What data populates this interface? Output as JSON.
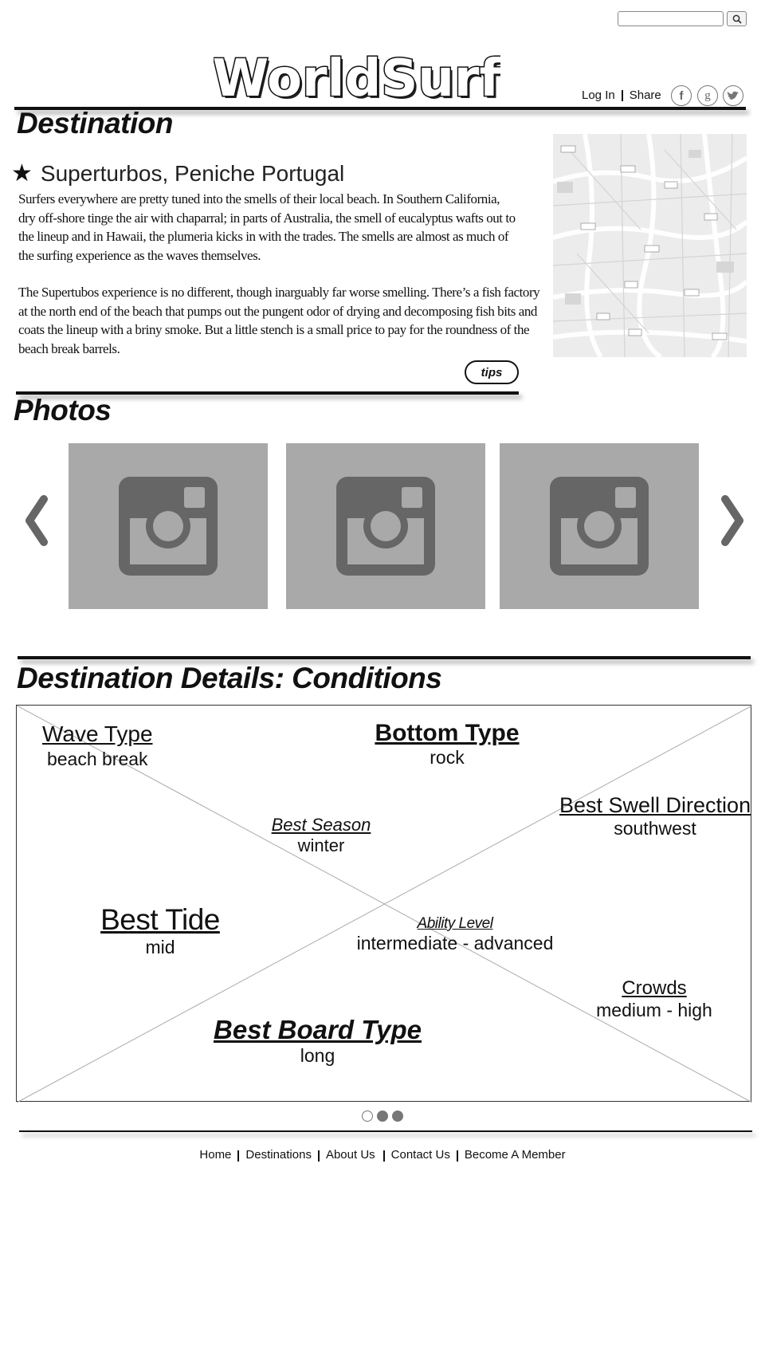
{
  "search": {
    "value": "",
    "placeholder": ""
  },
  "logo_text": "WorldSurf",
  "header": {
    "login": "Log In",
    "share": "Share"
  },
  "social": [
    "facebook-icon",
    "google-icon",
    "twitter-icon"
  ],
  "destination": {
    "title": "Destination",
    "name": "Superturbos, Peniche Portugal",
    "paragraphs": [
      "Surfers everywhere are pretty tuned into the smells of their local beach.  In Southern California, dry off-shore tinge the air with chaparral; in parts of Australia, the smell of eucalyptus wafts out to the lineup and in Hawaii, the plumeria kicks in with the trades.  The smells are almost as much of the surfing experience as the waves themselves.",
      "The Supertubos experience is no different, though inarguably far worse smelling.  There’s a fish factory at the north end of the beach that pumps out the pungent odor of drying and decomposing fish bits and coats the lineup with a briny smoke.  But a little stench is a small price to pay for the roundness of the beach break barrels."
    ],
    "tips_label": "tips"
  },
  "photos": {
    "title": "Photos",
    "count": 3
  },
  "details": {
    "title": "Destination Details: Conditions",
    "wave_type": {
      "label": "Wave Type",
      "value": "beach break"
    },
    "bottom_type": {
      "label": "Bottom Type",
      "value": "rock"
    },
    "best_swell_direction": {
      "label": "Best Swell Direction",
      "value": "southwest"
    },
    "best_season": {
      "label": "Best Season",
      "value": "winter"
    },
    "best_tide": {
      "label": "Best Tide",
      "value": "mid"
    },
    "ability_level": {
      "label": "Ability Level",
      "value": "intermediate - advanced"
    },
    "crowds": {
      "label": "Crowds",
      "value": "medium - high"
    },
    "best_board_type": {
      "label": "Best Board Type",
      "value": "long"
    },
    "pager": {
      "pages": 3,
      "current": 1
    }
  },
  "footer": {
    "links": [
      "Home",
      "Destinations",
      "About Us",
      "Contact Us",
      "Become A Member"
    ]
  },
  "colors": {
    "text": "#111111",
    "photo_placeholder": "#a9a9a9",
    "icon_dark": "#666666"
  }
}
